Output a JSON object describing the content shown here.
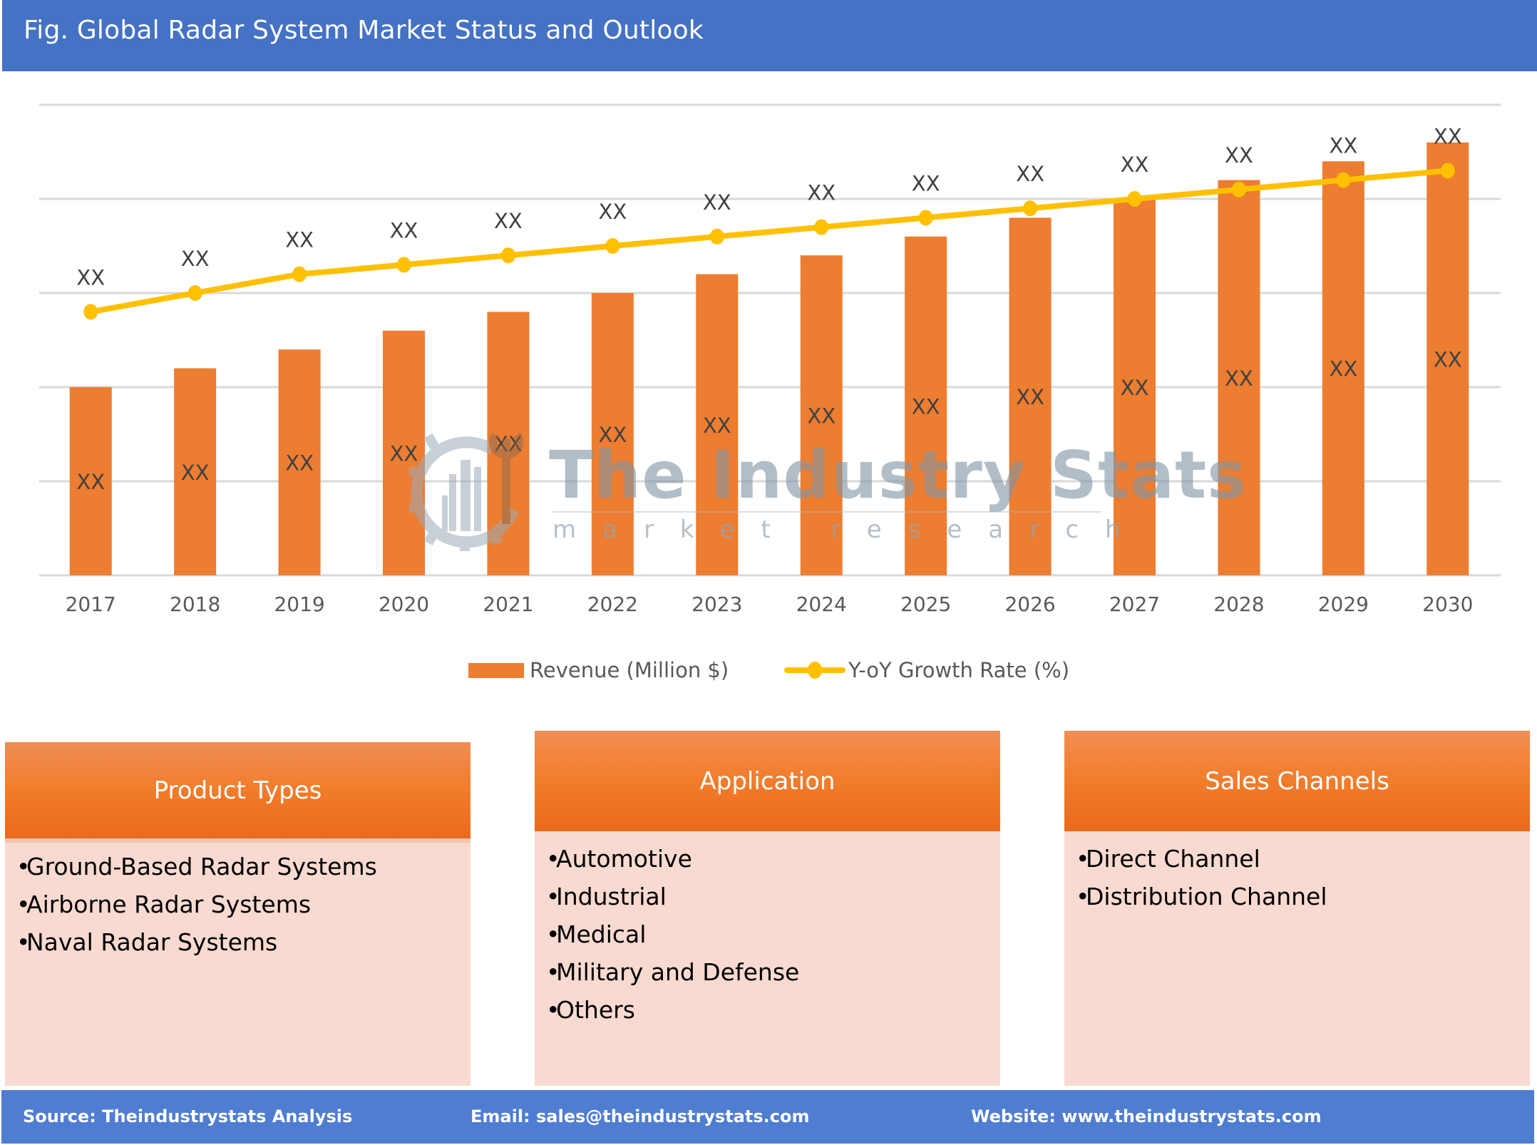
{
  "header": {
    "title": "Fig. Global Radar System Market Status and Outlook"
  },
  "colors": {
    "header_bg": "#4472c4",
    "bar": "#ed7d31",
    "line": "#ffc000",
    "gridline": "#d9d9d9",
    "segment_header": "#f27e2e",
    "segment_body": "#f8dad0",
    "footer_bg": "#4e7dd1"
  },
  "chart_data": {
    "type": "bar",
    "title": "Global Radar System Market Status and Outlook",
    "xlabel": "",
    "ylabel": "",
    "categories": [
      "2017",
      "2018",
      "2019",
      "2020",
      "2021",
      "2022",
      "2023",
      "2024",
      "2025",
      "2026",
      "2027",
      "2028",
      "2029",
      "2030"
    ],
    "ylim": [
      0,
      5
    ],
    "grid": true,
    "y_tick_labels_shown": false,
    "series": [
      {
        "name": "Revenue (Million $)",
        "type": "bar",
        "values": [
          2.0,
          2.2,
          2.4,
          2.6,
          2.8,
          3.0,
          3.2,
          3.4,
          3.6,
          3.8,
          4.0,
          4.2,
          4.4,
          4.6
        ],
        "data_labels": [
          "XX",
          "XX",
          "XX",
          "XX",
          "XX",
          "XX",
          "XX",
          "XX",
          "XX",
          "XX",
          "XX",
          "XX",
          "XX",
          "XX"
        ]
      },
      {
        "name": "Y-oY Growth Rate (%)",
        "type": "line",
        "values": [
          2.8,
          3.0,
          3.2,
          3.3,
          3.4,
          3.5,
          3.6,
          3.7,
          3.8,
          3.9,
          4.0,
          4.1,
          4.2,
          4.3
        ],
        "data_labels": [
          "XX",
          "XX",
          "XX",
          "XX",
          "XX",
          "XX",
          "XX",
          "XX",
          "XX",
          "XX",
          "XX",
          "XX",
          "XX",
          "XX"
        ]
      }
    ],
    "legend": {
      "position": "bottom",
      "entries": [
        "Revenue (Million $)",
        "Y-oY Growth Rate (%)"
      ]
    },
    "note": "Values are relative (axis unlabeled; data labels masked as XX)"
  },
  "watermark": {
    "title": "The Industry Stats",
    "subtitle": "market research",
    "icon": "gear-wrench-factory-icon"
  },
  "segments": [
    {
      "title": "Product Types",
      "items": [
        "Ground-Based Radar Systems",
        "Airborne Radar Systems",
        "Naval Radar Systems"
      ]
    },
    {
      "title": "Application",
      "items": [
        "Automotive",
        "Industrial",
        "Medical",
        "Military and Defense",
        "Others"
      ]
    },
    {
      "title": "Sales Channels",
      "items": [
        "Direct Channel",
        "Distribution Channel"
      ]
    }
  ],
  "bullet": "•",
  "footer": {
    "source": "Source: Theindustrystats Analysis",
    "email": "Email: sales@theindustrystats.com",
    "website": "Website: www.theindustrystats.com"
  }
}
